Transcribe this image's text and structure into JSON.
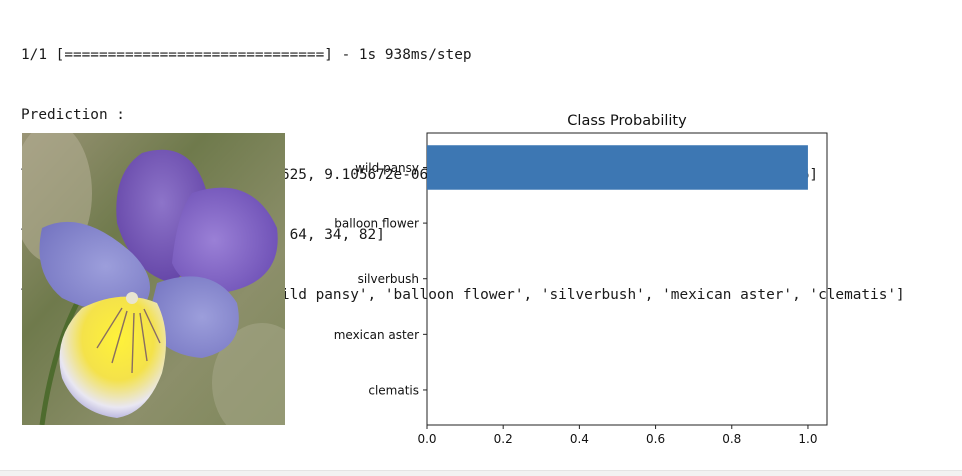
{
  "console": {
    "lines": [
      "1/1 [==============================] - 1s 938ms/step",
      "Prediction :",
      "TOP 5 Probabilities = [0.99995625, 9.105672e-06, 7.3015153e-06, 7.020553e-06, 4.4961885e-06]",
      "TOP 5 Flower Labels = [52, 19, 64, 34, 82]",
      "TOP 5 Flower Class Names = ['wild pansy', 'balloon flower', 'silverbush', 'mexican aster', 'clematis']"
    ]
  },
  "chart_data": {
    "type": "bar",
    "orientation": "horizontal",
    "title": "Class Probability",
    "xlabel": "",
    "ylabel": "",
    "categories": [
      "wild pansy",
      "balloon flower",
      "silverbush",
      "mexican aster",
      "clematis"
    ],
    "values": [
      0.99995625,
      9.105672e-06,
      7.3015153e-06,
      7.020553e-06,
      4.4961885e-06
    ],
    "xlim": [
      0.0,
      1.05
    ],
    "xticks": [
      "0.0",
      "0.2",
      "0.4",
      "0.6",
      "0.8",
      "1.0"
    ],
    "grid": false,
    "bar_color": "#3d77b3"
  }
}
